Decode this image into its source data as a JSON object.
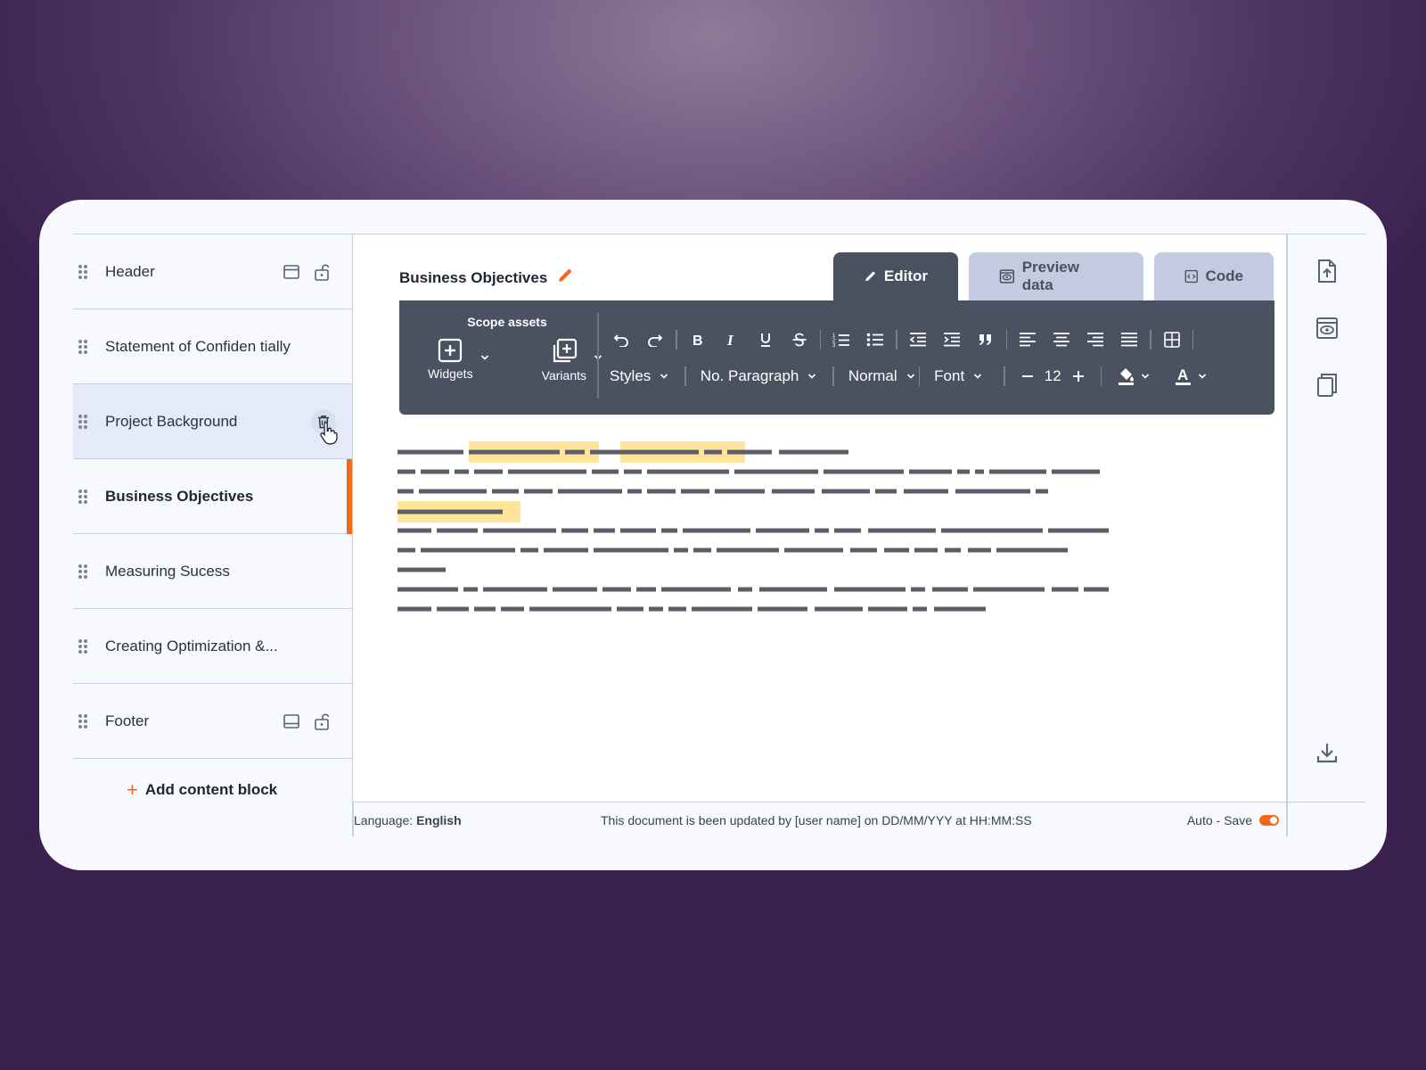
{
  "sidebar": {
    "items": [
      {
        "label": "Header"
      },
      {
        "label": "Statement  of Confiden tially"
      },
      {
        "label": "Project Background"
      },
      {
        "label": "Business Objectives"
      },
      {
        "label": "Measuring Sucess"
      },
      {
        "label": "Creating  Optimization &..."
      },
      {
        "label": "Footer"
      }
    ],
    "add_block": "Add content block"
  },
  "document": {
    "title": "Business Objectives"
  },
  "tabs": {
    "editor": "Editor",
    "preview": "Preview data",
    "code": "Code"
  },
  "toolbar": {
    "scope_title": "Scope assets",
    "widgets": "Widgets",
    "variants": "Variants",
    "styles": "Styles",
    "paragraph": "No. Paragraph",
    "normal": "Normal",
    "font": "Font",
    "font_size": "12"
  },
  "footer": {
    "language_label": "Language:",
    "language_value": "English",
    "updated": "This document is been updated by [user name] on DD/MM/YYY at HH:MM:SS",
    "autosave": "Auto - Save"
  },
  "colors": {
    "accent": "#f26b1d",
    "toolbar": "#4a5160",
    "highlight": "#ffe49a",
    "text_placeholder": "#5a5f68"
  },
  "icons": {
    "rail": [
      "export-icon",
      "preview-icon",
      "copy-icon",
      "download-icon"
    ]
  }
}
